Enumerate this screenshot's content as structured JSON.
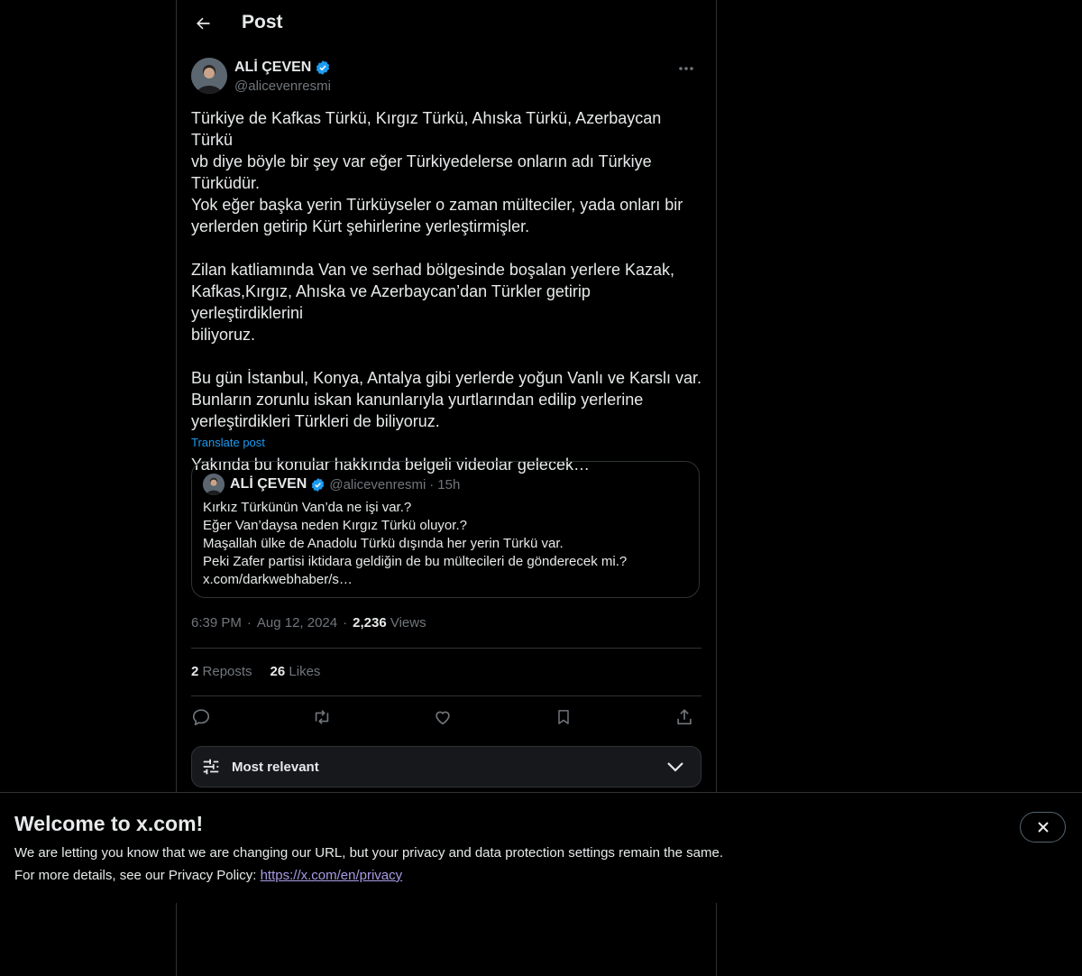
{
  "header": {
    "title": "Post"
  },
  "post": {
    "author_name": "ALİ ÇEVEN",
    "author_handle": "@alicevenresmi",
    "text": "Türkiye de Kafkas Türkü, Kırgız Türkü, Ahıska Türkü, Azerbaycan Türkü\nvb diye böyle bir şey var eğer Türkiyedelerse onların adı Türkiye\nTürküdür.\nYok eğer başka yerin Türküyseler o zaman mülteciler, yada onları bir\nyerlerden getirip Kürt şehirlerine yerleştirmişler.\n\nZilan katliamında Van ve serhad bölgesinde boşalan yerlere Kazak,\nKafkas,Kırgız, Ahıska ve Azerbaycan’dan Türkler getirip yerleştirdiklerini\nbiliyoruz.\n\nBu gün İstanbul, Konya, Antalya gibi yerlerde yoğun Vanlı ve Karslı var.\nBunların zorunlu iskan kanunlarıyla yurtlarından edilip yerlerine\nyerleştirdikleri Türkleri de biliyoruz.\n\nYakında bu konular hakkında belgeli videolar gelecek…",
    "translate_label": "Translate post",
    "time": "6:39 PM",
    "date": "Aug 12, 2024",
    "views_count": "2,236",
    "views_label": "Views",
    "reposts_count": "2",
    "reposts_label": "Reposts",
    "likes_count": "26",
    "likes_label": "Likes"
  },
  "quote": {
    "author_name": "ALİ ÇEVEN",
    "author_handle": "@alicevenresmi",
    "separator": "·",
    "time": "15h",
    "text": "Kırkız Türkünün Van’da ne işi var.?\nEğer Van’daysa neden Kırgız Türkü oluyor.?\nMaşallah ülke de Anadolu Türkü dışında her yerin Türkü var.\nPeki Zafer partisi iktidara geldiğin de bu mültecileri de gönderecek mi.?\nx.com/darkwebhaber/s…"
  },
  "meta": {
    "separator": "·"
  },
  "sort": {
    "label": "Most relevant"
  },
  "banner": {
    "title": "Welcome to x.com!",
    "line1": "We are letting you know that we are changing our URL, but your privacy and data protection settings remain the same.",
    "line2_prefix": "For more details, see our Privacy Policy: ",
    "link": "https://x.com/en/privacy"
  },
  "colors": {
    "background": "#000000",
    "text": "#e7e9ea",
    "muted": "#71767b",
    "accent": "#1d9bf0",
    "border": "#2f3336",
    "link_visited": "#a99be5"
  },
  "icons": [
    "back-arrow-icon",
    "verified-badge-icon",
    "more-icon",
    "reply-icon",
    "repost-icon",
    "like-icon",
    "bookmark-icon",
    "share-icon",
    "sliders-icon",
    "chevron-down-icon",
    "close-icon"
  ]
}
